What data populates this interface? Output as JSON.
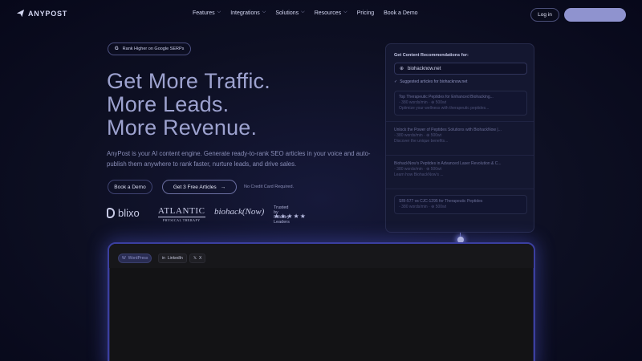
{
  "nav": {
    "brand": "ANYPOST",
    "menu": [
      {
        "label": "Features",
        "dropdown": true
      },
      {
        "label": "Integrations",
        "dropdown": true
      },
      {
        "label": "Solutions",
        "dropdown": true
      },
      {
        "label": "Resources",
        "dropdown": true
      },
      {
        "label": "Pricing",
        "dropdown": false
      },
      {
        "label": "Book a Demo",
        "dropdown": false
      }
    ],
    "login": "Log in"
  },
  "hero": {
    "badge": "Rank Higher on Google SERPs",
    "badge_icon": "G",
    "headline": [
      "Get More Traffic.",
      "More Leads.",
      "More Revenue."
    ],
    "subtext": "AnyPost is your AI content engine. Generate ready-to-rank SEO articles in your voice and auto-publish them anywhere to rank faster, nurture leads, and drive sales.",
    "btn_demo": "Book a Demo",
    "btn_free": "Get 3 Free Articles",
    "btn_free_arrow": "→",
    "no_cc": "No Credit Card Required."
  },
  "logos": {
    "blixo": "blixo",
    "atlantic_1": "ATLANTIC",
    "atlantic_2": "PHYSICAL THERAPY",
    "biohack": "biohack(Now)",
    "trusted": "Trusted by Industry Leaders",
    "stars": "★★★★★"
  },
  "card": {
    "title": "Get Content Recommendations for:",
    "domain": "biohacknow.net",
    "suggested": "Suggested articles for biohacknow.net",
    "articles": [
      {
        "title": "Top Therapeutic Peptides for Enhanced Biohacking...",
        "meta": "◦ 380 words/min · ⊕ 500wt",
        "desc": "Optimize your wellness with therapeutic peptides..."
      },
      {
        "title": "Unlock the Power of Peptides Solutions with BiohackNow |...",
        "meta": "◦ 380 words/min · ⊕ 500wt",
        "desc": "Discover the unique benefits..."
      },
      {
        "title": "BiohackNow's Peptides in Advanced Laser Revolution & C...",
        "meta": "◦ 380 words/min · ⊕ 500wt",
        "desc": "Learn how BiohackNow's ..."
      },
      {
        "title": "SRI-577 vs CJC-1295 for Therapeutic Peptides",
        "meta": "◦ 380 words/min · ⊕ 500wt",
        "desc": ""
      }
    ]
  },
  "frame": {
    "chips": [
      {
        "label": "WordPress",
        "icon": "W",
        "active": true
      },
      {
        "label": "LinkedIn",
        "icon": "in",
        "active": false
      },
      {
        "label": "X",
        "icon": "𝕏",
        "active": false
      }
    ]
  },
  "colors": {
    "background": "#0c0e1f",
    "headline": "#9da2cf",
    "cta": "#8f93cf",
    "frame_glow": "#3b3fa0"
  }
}
